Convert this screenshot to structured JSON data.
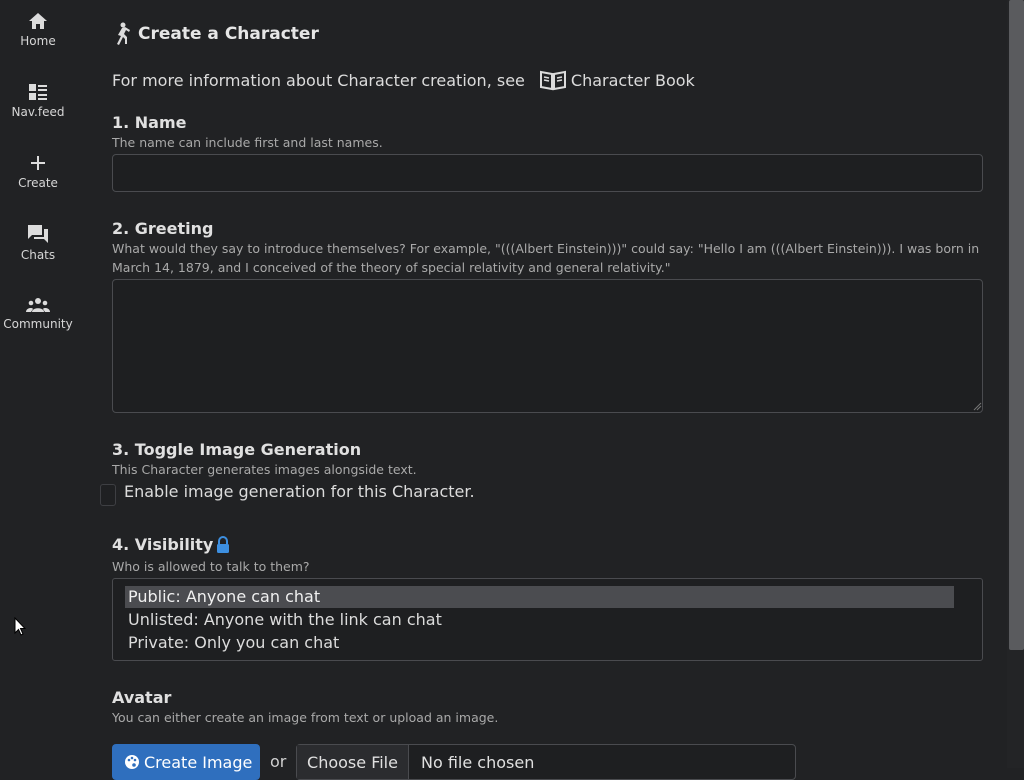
{
  "sidebar": {
    "items": [
      {
        "label": "Home",
        "icon": "home-icon"
      },
      {
        "label": "Nav.feed",
        "icon": "feed-icon"
      },
      {
        "label": "Create",
        "icon": "plus-icon"
      },
      {
        "label": "Chats",
        "icon": "chat-icon"
      },
      {
        "label": "Community",
        "icon": "people-icon"
      }
    ]
  },
  "header": {
    "title": "Create a Character",
    "info_text": "For more information about Character creation, see",
    "book_link": "Character Book"
  },
  "name_section": {
    "title": "1. Name",
    "description": "The name can include first and last names.",
    "value": ""
  },
  "greeting_section": {
    "title": "2. Greeting",
    "description": "What would they say to introduce themselves? For example, \"(((Albert Einstein)))\" could say: \"Hello I am (((Albert Einstein))). I was born in March 14, 1879, and I conceived of the theory of special relativity and general relativity.\"",
    "value": ""
  },
  "image_gen_section": {
    "title": "3. Toggle Image Generation",
    "description": "This Character generates images alongside text.",
    "checkbox_label": "Enable image generation for this Character.",
    "checked": false
  },
  "visibility_section": {
    "title": "4. Visibility",
    "description": "Who is allowed to talk to them?",
    "options": [
      "Public: Anyone can chat",
      "Unlisted: Anyone with the link can chat",
      "Private: Only you can chat"
    ],
    "selected": "Public: Anyone can chat"
  },
  "avatar_section": {
    "title": "Avatar",
    "description": "You can either create an image from text or upload an image.",
    "create_button": "Create Image",
    "or_text": "or",
    "choose_file": "Choose File",
    "file_status": "No file chosen"
  },
  "colors": {
    "background": "#212224",
    "accent": "#2f6fbe",
    "lock_icon": "#3d8fe0"
  }
}
